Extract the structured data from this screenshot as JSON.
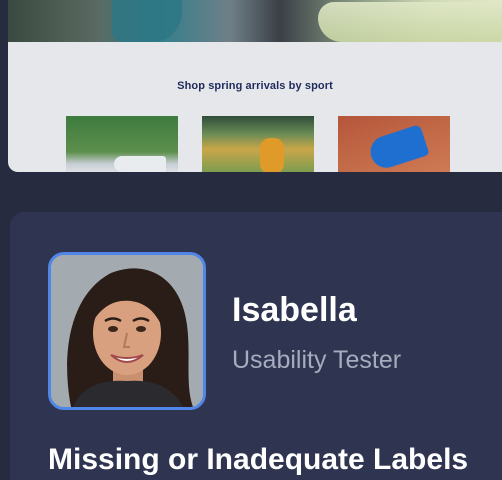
{
  "site_preview": {
    "promo_heading": "Shop spring arrivals by sport",
    "tiles": [
      {
        "name": "sport-tile-1"
      },
      {
        "name": "sport-tile-2"
      },
      {
        "name": "sport-tile-3"
      }
    ]
  },
  "profile": {
    "name": "Isabella",
    "role": "Usability Tester",
    "accent_color": "#4f86e8"
  },
  "issue": {
    "title": "Missing or Inadequate Labels"
  },
  "colors": {
    "background": "#262b40",
    "card": "#2f3550",
    "preview_bg": "#e6e7eb",
    "heading_text": "#1f2b5c"
  }
}
